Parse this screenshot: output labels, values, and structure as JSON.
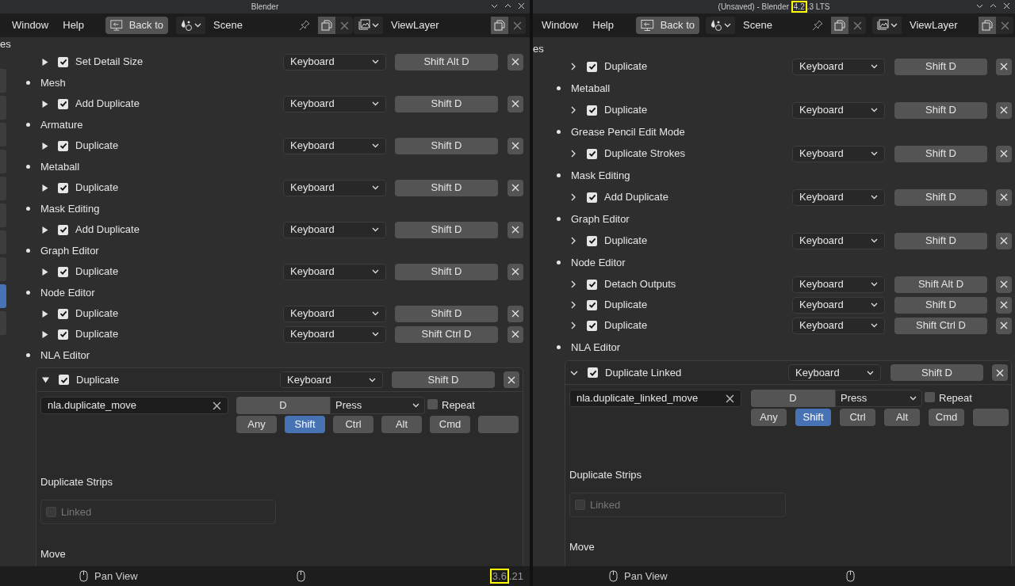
{
  "panes": [
    {
      "title": [
        {
          "text": "Blender",
          "highlighted": false
        }
      ],
      "kind": "triangle",
      "sidebar_tabs": [
        {
          "selected": false
        },
        {
          "selected": false
        },
        {
          "selected": false
        },
        {
          "selected": false
        },
        {
          "selected": false
        },
        {
          "selected": false
        },
        {
          "selected": false
        },
        {
          "selected": false
        },
        {
          "selected": true
        },
        {
          "selected": false
        }
      ],
      "menu": [
        "Window",
        "Help"
      ],
      "back_button": "Back to",
      "scene": "Scene",
      "view_layer": "ViewLayer",
      "cut_label": "es",
      "groups": [
        {
          "items": [
            {
              "label": "Set Detail Size",
              "checked": true,
              "expanded": false,
              "map_type": "Keyboard",
              "key": "Shift Alt D"
            }
          ]
        },
        {
          "name": "Mesh",
          "items": [
            {
              "label": "Add Duplicate",
              "checked": true,
              "expanded": false,
              "map_type": "Keyboard",
              "key": "Shift D"
            }
          ]
        },
        {
          "name": "Armature",
          "items": [
            {
              "label": "Duplicate",
              "checked": true,
              "expanded": false,
              "map_type": "Keyboard",
              "key": "Shift D"
            }
          ]
        },
        {
          "name": "Metaball",
          "items": [
            {
              "label": "Duplicate",
              "checked": true,
              "expanded": false,
              "map_type": "Keyboard",
              "key": "Shift D"
            }
          ]
        },
        {
          "name": "Mask Editing",
          "items": [
            {
              "label": "Add Duplicate",
              "checked": true,
              "expanded": false,
              "map_type": "Keyboard",
              "key": "Shift D"
            }
          ]
        },
        {
          "name": "Graph Editor",
          "items": [
            {
              "label": "Duplicate",
              "checked": true,
              "expanded": false,
              "map_type": "Keyboard",
              "key": "Shift D"
            }
          ]
        },
        {
          "name": "Node Editor",
          "items": [
            {
              "label": "Duplicate",
              "checked": true,
              "expanded": false,
              "map_type": "Keyboard",
              "key": "Shift D"
            },
            {
              "label": "Duplicate",
              "checked": true,
              "expanded": false,
              "map_type": "Keyboard",
              "key": "Shift Ctrl D"
            }
          ]
        },
        {
          "name": "NLA Editor",
          "items": [
            {
              "label": "Duplicate",
              "checked": true,
              "expanded": true,
              "map_type": "Keyboard",
              "key": "Shift D"
            }
          ]
        }
      ],
      "detail": {
        "idname": "nla.duplicate_move",
        "event_key": "D",
        "event_value": "Press",
        "repeat": {
          "label": "Repeat",
          "checked": false
        },
        "modifiers": [
          {
            "label": "Any",
            "selected": false
          },
          {
            "label": "Shift",
            "selected": true
          },
          {
            "label": "Ctrl",
            "selected": false
          },
          {
            "label": "Alt",
            "selected": false
          },
          {
            "label": "Cmd",
            "selected": false
          },
          {
            "selected": false
          }
        ],
        "section": "Duplicate Strips",
        "property": {
          "label": "Linked",
          "checked": false,
          "disabled": true
        },
        "next_section": "Move"
      },
      "status": {
        "hint": "Pan View",
        "version": [
          {
            "text": "3.6",
            "highlighted": true
          },
          {
            "text": ".21",
            "highlighted": false
          }
        ]
      }
    },
    {
      "title": [
        {
          "text": "(Unsaved) - Blender ",
          "highlighted": false
        },
        {
          "text": "4.2",
          "highlighted": true
        },
        {
          "text": ".3 LTS",
          "highlighted": false
        }
      ],
      "kind": "chevron",
      "menu": [
        "Window",
        "Help"
      ],
      "back_button": "Back to",
      "scene": "Scene",
      "view_layer": "ViewLayer",
      "cut_label": "es",
      "groups": [
        {
          "items": [
            {
              "label": "Duplicate",
              "checked": true,
              "expanded": false,
              "map_type": "Keyboard",
              "key": "Shift D"
            }
          ]
        },
        {
          "name": "Metaball",
          "items": [
            {
              "label": "Duplicate",
              "checked": true,
              "expanded": false,
              "map_type": "Keyboard",
              "key": "Shift D"
            }
          ]
        },
        {
          "name": "Grease Pencil Edit Mode",
          "items": [
            {
              "label": "Duplicate Strokes",
              "checked": true,
              "expanded": false,
              "map_type": "Keyboard",
              "key": "Shift D"
            }
          ]
        },
        {
          "name": "Mask Editing",
          "items": [
            {
              "label": "Add Duplicate",
              "checked": true,
              "expanded": false,
              "map_type": "Keyboard",
              "key": "Shift D"
            }
          ]
        },
        {
          "name": "Graph Editor",
          "items": [
            {
              "label": "Duplicate",
              "checked": true,
              "expanded": false,
              "map_type": "Keyboard",
              "key": "Shift D"
            }
          ]
        },
        {
          "name": "Node Editor",
          "items": [
            {
              "label": "Detach Outputs",
              "checked": true,
              "expanded": false,
              "map_type": "Keyboard",
              "key": "Shift Alt D"
            },
            {
              "label": "Duplicate",
              "checked": true,
              "expanded": false,
              "map_type": "Keyboard",
              "key": "Shift D"
            },
            {
              "label": "Duplicate",
              "checked": true,
              "expanded": false,
              "map_type": "Keyboard",
              "key": "Shift Ctrl D"
            }
          ]
        },
        {
          "name": "NLA Editor",
          "items": [
            {
              "label": "Duplicate Linked",
              "checked": true,
              "expanded": true,
              "map_type": "Keyboard",
              "key": "Shift D"
            }
          ]
        }
      ],
      "detail": {
        "idname": "nla.duplicate_linked_move",
        "event_key": "D",
        "event_value": "Press",
        "repeat": {
          "label": "Repeat",
          "checked": false
        },
        "modifiers": [
          {
            "label": "Any",
            "selected": false
          },
          {
            "label": "Shift",
            "selected": true
          },
          {
            "label": "Ctrl",
            "selected": false
          },
          {
            "label": "Alt",
            "selected": false
          },
          {
            "label": "Cmd",
            "selected": false
          },
          {
            "selected": false
          }
        ],
        "section": "Duplicate Strips",
        "property": {
          "label": "Linked",
          "checked": false,
          "disabled": true
        },
        "next_section": "Move"
      },
      "status": {
        "hint": "Pan View"
      }
    }
  ]
}
